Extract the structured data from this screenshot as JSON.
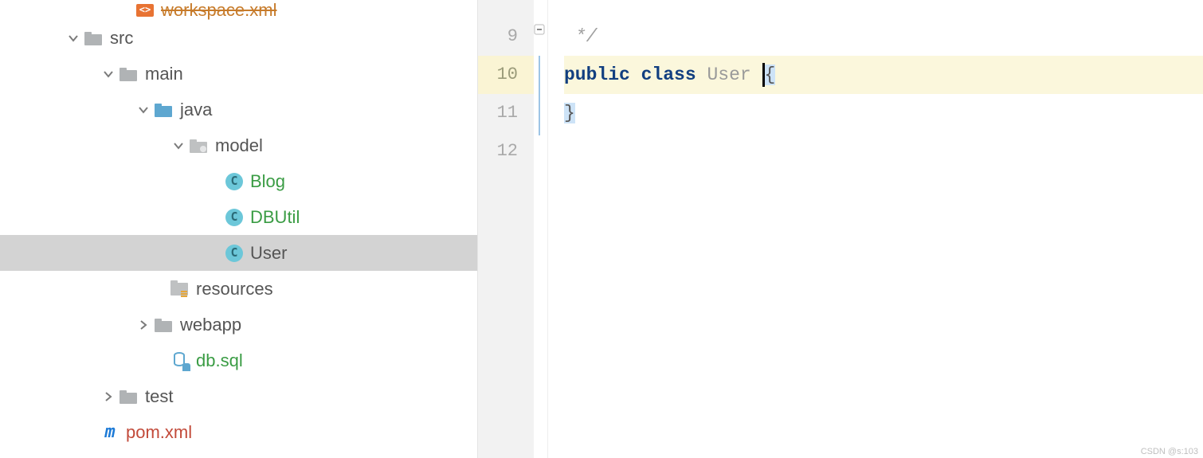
{
  "tree": {
    "workspace_xml": "workspace.xml",
    "src": "src",
    "main": "main",
    "java": "java",
    "model": "model",
    "blog": "Blog",
    "dbutil": "DBUtil",
    "user": "User",
    "resources": "resources",
    "webapp": "webapp",
    "dbsql": "db.sql",
    "test": "test",
    "pom": "pom.xml",
    "class_glyph": "C",
    "maven_glyph": "m",
    "xml_glyph": "<>"
  },
  "editor": {
    "lines": {
      "l9": "9",
      "l10": "10",
      "l11": "11",
      "l12": "12"
    },
    "code": {
      "comment_close": "*/",
      "kw_public": "public",
      "kw_class": "class",
      "class_name": "User",
      "brace_open": "{",
      "brace_close": "}"
    }
  },
  "watermark": "CSDN @s:103"
}
